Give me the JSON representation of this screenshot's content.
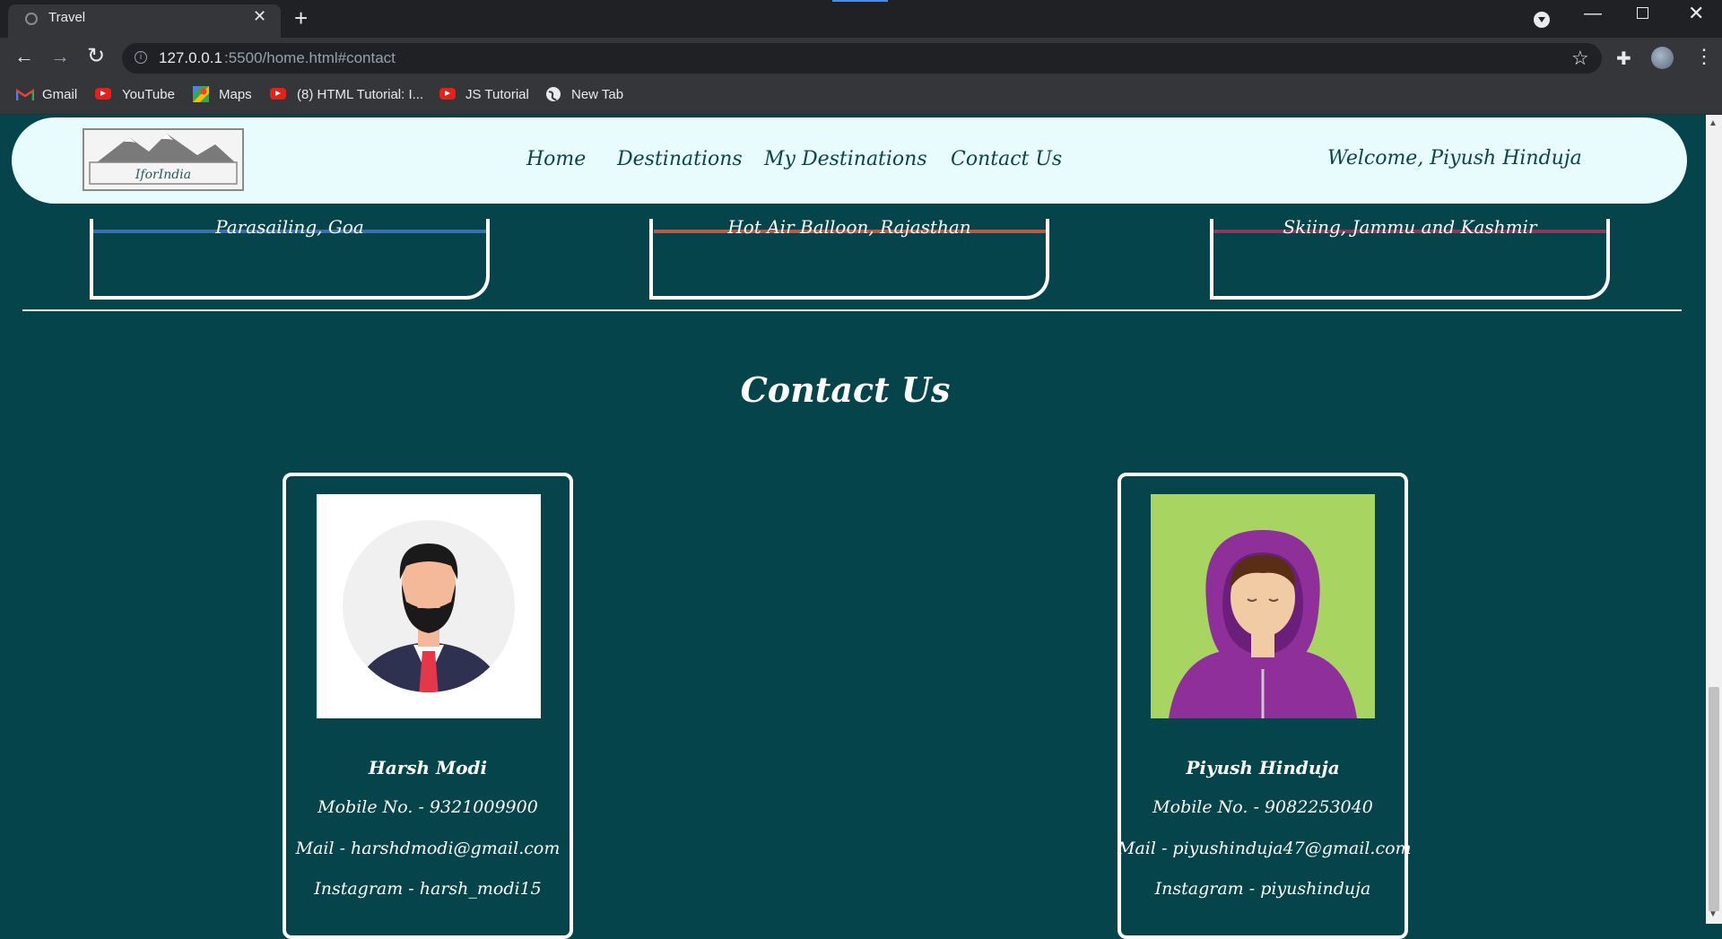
{
  "browser": {
    "tab_title": "Travel",
    "tab_close": "✕",
    "new_tab": "+",
    "url_host": "127.0.0.1",
    "url_path": ":5500/home.html#contact",
    "bookmarks": [
      "Gmail",
      "YouTube",
      "Maps",
      "(8) HTML Tutorial: I...",
      "JS Tutorial",
      "New Tab"
    ]
  },
  "nav": {
    "logo_text": "IforIndia",
    "links": [
      "Home",
      "Destinations",
      "My Destinations",
      "Contact Us"
    ],
    "welcome": "Welcome, Piyush Hinduja"
  },
  "destinations": [
    "Parasailing, Goa",
    "Hot Air Balloon, Rajasthan",
    "Skiing, Jammu and Kashmir"
  ],
  "contact": {
    "title": "Contact Us",
    "people": [
      {
        "name": "Harsh Modi",
        "mobile": "Mobile No. - 9321009900",
        "mail": "Mail - harshdmodi@gmail.com",
        "instagram": "Instagram - harsh_modi15"
      },
      {
        "name": "Piyush Hinduja",
        "mobile": "Mobile No. - 9082253040",
        "mail": "Mail - piyushinduja47@gmail.com",
        "instagram": "Instagram - piyushinduja"
      }
    ]
  },
  "colors": {
    "page_bg": "#04444a",
    "nav_bg": "#e8fbfd",
    "nav_text": "#0c4448"
  }
}
